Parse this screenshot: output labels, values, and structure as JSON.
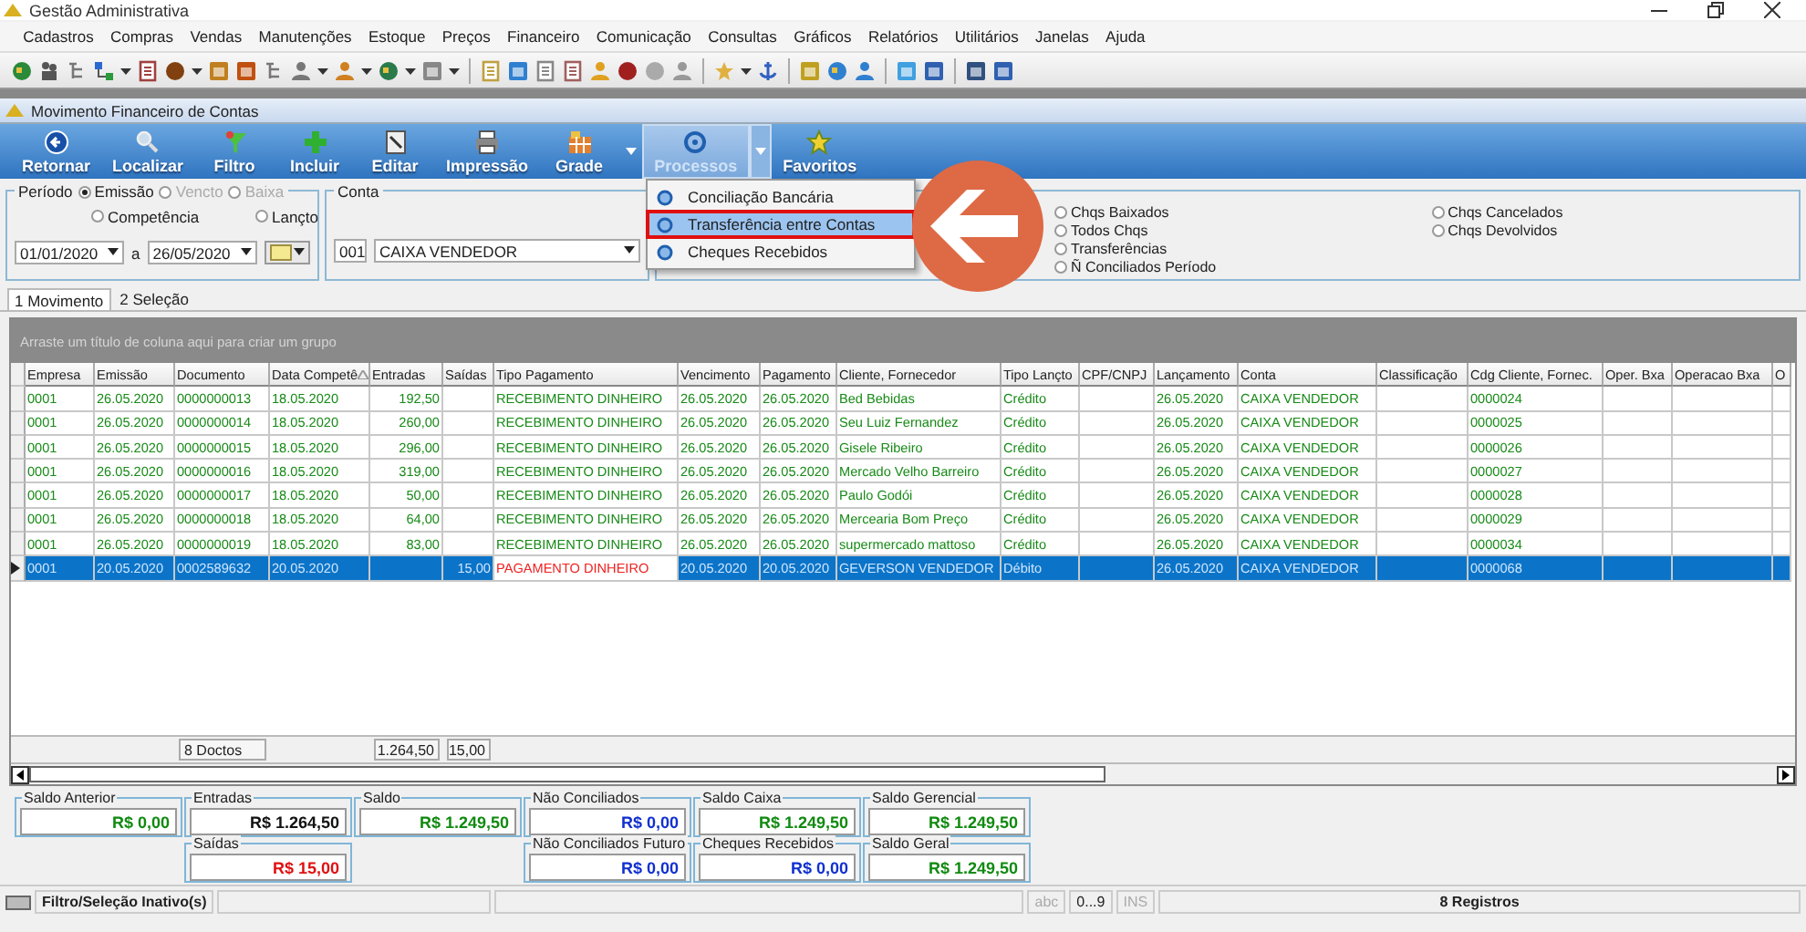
{
  "window": {
    "title": "Gestão Administrativa"
  },
  "menu": [
    "Cadastros",
    "Compras",
    "Vendas",
    "Manutenções",
    "Estoque",
    "Preços",
    "Financeiro",
    "Comunicação",
    "Consultas",
    "Gráficos",
    "Relatórios",
    "Utilitários",
    "Janelas",
    "Ajuda"
  ],
  "child_window": {
    "title": "Movimento Financeiro de Contas"
  },
  "ribbon": [
    {
      "label": "Retornar",
      "selected": false,
      "dropdown": false
    },
    {
      "label": "Localizar",
      "selected": false,
      "dropdown": false
    },
    {
      "label": "Filtro",
      "selected": false,
      "dropdown": false
    },
    {
      "label": "Incluir",
      "selected": false,
      "dropdown": false
    },
    {
      "label": "Editar",
      "selected": false,
      "dropdown": false
    },
    {
      "label": "Impressão",
      "selected": false,
      "dropdown": false
    },
    {
      "label": "Grade",
      "selected": false,
      "dropdown": true
    },
    {
      "label": "Processos",
      "selected": true,
      "dropdown": true
    },
    {
      "label": "Favoritos",
      "selected": false,
      "dropdown": false
    }
  ],
  "process_menu": [
    {
      "label": "Conciliação Bancária",
      "selected": false
    },
    {
      "label": "Transferência entre Contas",
      "selected": true
    },
    {
      "label": "Cheques Recebidos",
      "selected": false
    }
  ],
  "periodo": {
    "label": "Período",
    "options": [
      {
        "label": "Emissão",
        "selected": true,
        "disabled": false
      },
      {
        "label": "Vencto",
        "selected": false,
        "disabled": true
      },
      {
        "label": "Baixa",
        "selected": false,
        "disabled": true
      },
      {
        "label": "Competência",
        "selected": false,
        "disabled": false
      },
      {
        "label": "Lançto",
        "selected": false,
        "disabled": false
      }
    ],
    "date_from": "01/01/2020",
    "separator": "a",
    "date_to": "26/05/2020"
  },
  "conta": {
    "label": "Conta",
    "code": "001",
    "name": "CAIXA VENDEDOR"
  },
  "cheque_filters": {
    "column_1": [
      {
        "label": "Chqs Baixados",
        "selected": false
      },
      {
        "label": "Todos Chqs",
        "selected": false
      },
      {
        "label": "Transferências",
        "selected": false
      },
      {
        "label": "Ñ Conciliados Período",
        "selected": false
      }
    ],
    "column_2": [
      {
        "label": "Chqs Cancelados",
        "selected": false
      },
      {
        "label": "Chqs Devolvidos",
        "selected": false
      }
    ]
  },
  "tabs": [
    {
      "label": "1 Movimento",
      "selected": true
    },
    {
      "label": "2 Seleção",
      "selected": false
    }
  ],
  "grid": {
    "group_hint": "Arraste um título de coluna aqui para criar um grupo",
    "columns": [
      "Empresa",
      "Emissão",
      "Documento",
      "Data Competê",
      "Entradas",
      "Saídas",
      "Tipo Pagamento",
      "Vencimento",
      "Pagamento",
      "Cliente, Fornecedor",
      "Tipo Lançto",
      "CPF/CNPJ",
      "Lançamento",
      "Conta",
      "Classificação",
      "Cdg Cliente, Fornec.",
      "Oper. Bxa",
      "Operacao Bxa",
      "O"
    ],
    "rows": [
      {
        "kind": "credit",
        "selected": false,
        "empresa": "0001",
        "emissao": "26.05.2020",
        "documento": "0000000013",
        "data_competencia": "18.05.2020",
        "entradas": "192,50",
        "tipo_pagamento": "RECEBIMENTO DINHEIRO",
        "vencimento": "26.05.2020",
        "pagamento": "26.05.2020",
        "cliente_fornecedor": "Bed Bebidas",
        "tipo_lancamento": "Crédito",
        "lancamento": "26.05.2020",
        "conta": "CAIXA VENDEDOR",
        "cdg_cliente": "0000024"
      },
      {
        "kind": "credit",
        "selected": false,
        "empresa": "0001",
        "emissao": "26.05.2020",
        "documento": "0000000014",
        "data_competencia": "18.05.2020",
        "entradas": "260,00",
        "tipo_pagamento": "RECEBIMENTO DINHEIRO",
        "vencimento": "26.05.2020",
        "pagamento": "26.05.2020",
        "cliente_fornecedor": "Seu Luiz Fernandez",
        "tipo_lancamento": "Crédito",
        "lancamento": "26.05.2020",
        "conta": "CAIXA VENDEDOR",
        "cdg_cliente": "0000025"
      },
      {
        "kind": "credit",
        "selected": false,
        "empresa": "0001",
        "emissao": "26.05.2020",
        "documento": "0000000015",
        "data_competencia": "18.05.2020",
        "entradas": "296,00",
        "tipo_pagamento": "RECEBIMENTO DINHEIRO",
        "vencimento": "26.05.2020",
        "pagamento": "26.05.2020",
        "cliente_fornecedor": "Gisele Ribeiro",
        "tipo_lancamento": "Crédito",
        "lancamento": "26.05.2020",
        "conta": "CAIXA VENDEDOR",
        "cdg_cliente": "0000026"
      },
      {
        "kind": "credit",
        "selected": false,
        "empresa": "0001",
        "emissao": "26.05.2020",
        "documento": "0000000016",
        "data_competencia": "18.05.2020",
        "entradas": "319,00",
        "tipo_pagamento": "RECEBIMENTO DINHEIRO",
        "vencimento": "26.05.2020",
        "pagamento": "26.05.2020",
        "cliente_fornecedor": "Mercado Velho Barreiro",
        "tipo_lancamento": "Crédito",
        "lancamento": "26.05.2020",
        "conta": "CAIXA VENDEDOR",
        "cdg_cliente": "0000027"
      },
      {
        "kind": "credit",
        "selected": false,
        "empresa": "0001",
        "emissao": "26.05.2020",
        "documento": "0000000017",
        "data_competencia": "18.05.2020",
        "entradas": "50,00",
        "tipo_pagamento": "RECEBIMENTO DINHEIRO",
        "vencimento": "26.05.2020",
        "pagamento": "26.05.2020",
        "cliente_fornecedor": "Paulo Godói",
        "tipo_lancamento": "Crédito",
        "lancamento": "26.05.2020",
        "conta": "CAIXA VENDEDOR",
        "cdg_cliente": "0000028"
      },
      {
        "kind": "credit",
        "selected": false,
        "empresa": "0001",
        "emissao": "26.05.2020",
        "documento": "0000000018",
        "data_competencia": "18.05.2020",
        "entradas": "64,00",
        "tipo_pagamento": "RECEBIMENTO DINHEIRO",
        "vencimento": "26.05.2020",
        "pagamento": "26.05.2020",
        "cliente_fornecedor": "Mercearia Bom Preço",
        "tipo_lancamento": "Crédito",
        "lancamento": "26.05.2020",
        "conta": "CAIXA VENDEDOR",
        "cdg_cliente": "0000029"
      },
      {
        "kind": "credit",
        "selected": false,
        "empresa": "0001",
        "emissao": "26.05.2020",
        "documento": "0000000019",
        "data_competencia": "18.05.2020",
        "entradas": "83,00",
        "tipo_pagamento": "RECEBIMENTO DINHEIRO",
        "vencimento": "26.05.2020",
        "pagamento": "26.05.2020",
        "cliente_fornecedor": "supermercado mattoso",
        "tipo_lancamento": "Crédito",
        "lancamento": "26.05.2020",
        "conta": "CAIXA VENDEDOR",
        "cdg_cliente": "0000034"
      },
      {
        "kind": "debit",
        "selected": true,
        "empresa": "0001",
        "emissao": "20.05.2020",
        "documento": "0002589632",
        "data_competencia": "20.05.2020",
        "saidas": "15,00",
        "tipo_pagamento": "PAGAMENTO DINHEIRO",
        "vencimento": "20.05.2020",
        "pagamento": "20.05.2020",
        "cliente_fornecedor": "GEVERSON VENDEDOR",
        "tipo_lancamento": "Débito",
        "lancamento": "26.05.2020",
        "conta": "CAIXA VENDEDOR",
        "cdg_cliente": "0000068"
      }
    ],
    "footer": {
      "documento": "8 Doctos",
      "entradas": "1.264,50",
      "saidas": "15,00"
    }
  },
  "totals": [
    {
      "label": "Saldo Anterior",
      "value": "R$ 0,00",
      "color": "#108a10"
    },
    {
      "label": "Entradas",
      "value": "R$ 1.264,50",
      "color": "#111111"
    },
    {
      "label": "Saldo",
      "value": "R$ 1.249,50",
      "color": "#108a10"
    },
    {
      "label": "Não Conciliados",
      "value": "R$ 0,00",
      "color": "#1030d0"
    },
    {
      "label": "Saldo Caixa",
      "value": "R$ 1.249,50",
      "color": "#108a10"
    },
    {
      "label": "Saldo Gerencial",
      "value": "R$ 1.249,50",
      "color": "#108a10"
    },
    {
      "label": "Saídas",
      "value": "R$ 15,00",
      "color": "#e01010"
    },
    {
      "label": "Não Conciliados Futuro",
      "value": "R$ 0,00",
      "color": "#1030d0"
    },
    {
      "label": "Cheques Recebidos",
      "value": "R$ 0,00",
      "color": "#1030d0"
    },
    {
      "label": "Saldo Geral",
      "value": "R$ 1.249,50",
      "color": "#108a10"
    }
  ],
  "status_bar": {
    "filter_status": "Filtro/Seleção Inativo(s)",
    "indicators": [
      {
        "label": "abc",
        "on": false
      },
      {
        "label": "0...9",
        "on": true
      },
      {
        "label": "INS",
        "on": false
      }
    ],
    "record_count": "8 Registros"
  }
}
